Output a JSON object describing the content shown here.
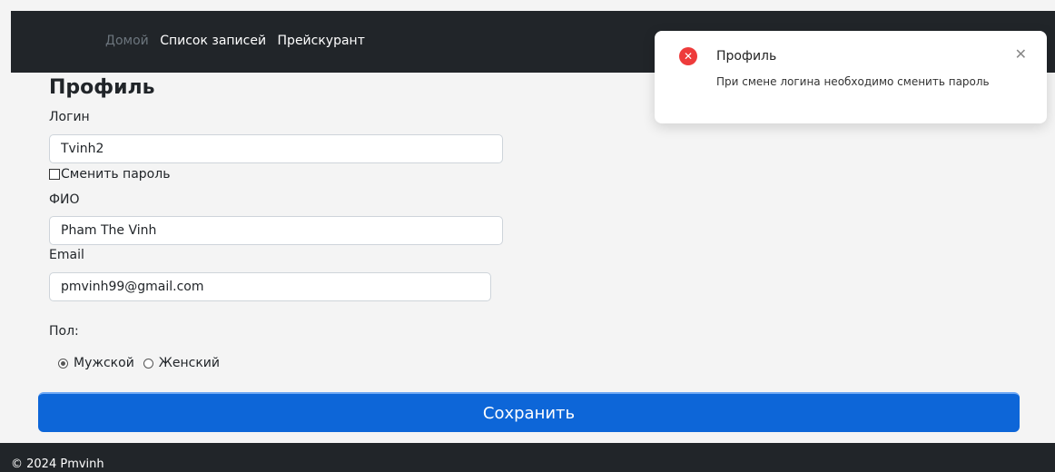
{
  "nav": {
    "home": "Домой",
    "records": "Список записей",
    "pricelist": "Прейскурант"
  },
  "page": {
    "title": "Профиль"
  },
  "form": {
    "login_label": "Логин",
    "login_value": "Tvinh2",
    "change_password_label": "Сменить пароль",
    "change_password_checked": false,
    "fio_label": "ФИО",
    "fio_value": "Pham The Vinh",
    "email_label": "Email",
    "email_value": "pmvinh99@gmail.com",
    "gender_label": "Пол:",
    "gender_options": [
      "Мужской",
      "Женский"
    ],
    "gender_selected": "Мужской",
    "save_label": "Сохранить"
  },
  "toast": {
    "title": "Профиль",
    "message": "При смене логина необходимо сменить пароль",
    "icon": "error-icon",
    "close_icon": "close-icon"
  },
  "footer": {
    "text": "© 2024 Pmvinh"
  },
  "colors": {
    "navbar": "#212529",
    "primary": "#0d66d8",
    "error": "#ee3b3b"
  }
}
